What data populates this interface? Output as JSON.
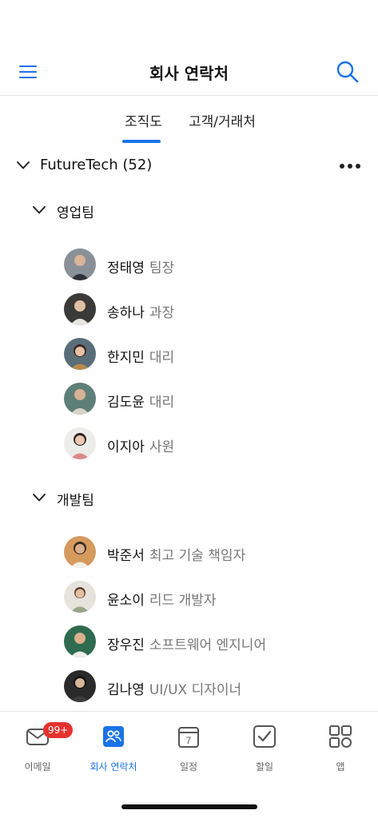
{
  "header": {
    "title": "회사 연락처",
    "menu_icon": "menu-icon",
    "search_icon": "search-icon",
    "accent_color": "#1a73e8"
  },
  "tabs": [
    {
      "label": "조직도",
      "active": true
    },
    {
      "label": "고객/거래처",
      "active": false
    }
  ],
  "company": {
    "name": "FutureTech (52)"
  },
  "teams": [
    {
      "name": "영업팀",
      "members": [
        {
          "name": "정태영",
          "role": "팀장"
        },
        {
          "name": "송하나",
          "role": "과장"
        },
        {
          "name": "한지민",
          "role": "대리"
        },
        {
          "name": "김도윤",
          "role": "대리"
        },
        {
          "name": "이지아",
          "role": "사원"
        }
      ]
    },
    {
      "name": "개발팀",
      "members": [
        {
          "name": "박준서",
          "role": "최고 기술 책임자"
        },
        {
          "name": "윤소이",
          "role": "리드 개발자"
        },
        {
          "name": "장우진",
          "role": "소프트웨어 엔지니어"
        },
        {
          "name": "김나영",
          "role": "UI/UX 디자이너"
        }
      ]
    }
  ],
  "tabbar": {
    "items": [
      {
        "label": "이메일",
        "icon": "mail-icon",
        "badge": "99+",
        "active": false
      },
      {
        "label": "회사 연락처",
        "icon": "contacts-icon",
        "active": true
      },
      {
        "label": "일정",
        "icon": "calendar-icon",
        "calendar_day": "7",
        "active": false
      },
      {
        "label": "할일",
        "icon": "todo-check-icon",
        "active": false
      },
      {
        "label": "앱",
        "icon": "apps-grid-icon",
        "active": false
      }
    ],
    "badge_color": "#e5322e"
  }
}
